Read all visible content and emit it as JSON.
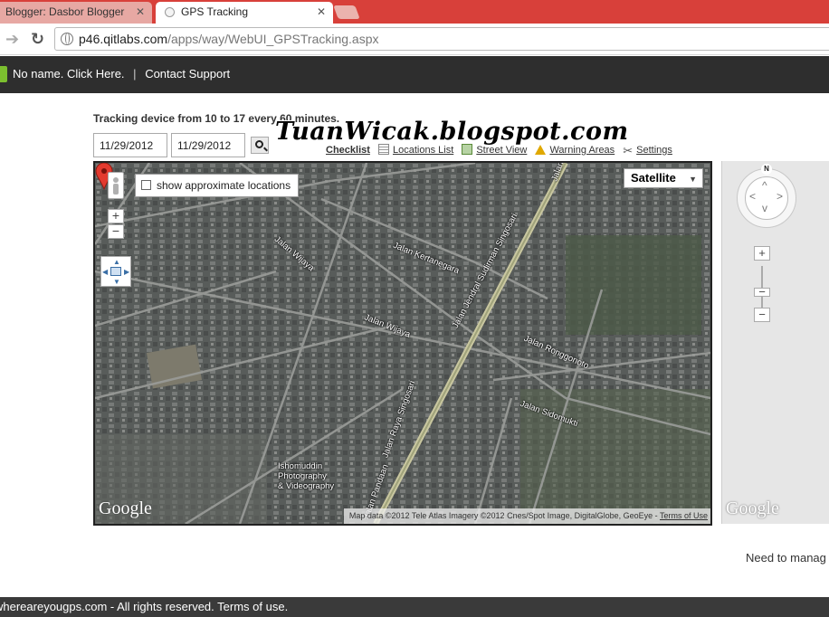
{
  "browser": {
    "tabs": [
      {
        "title": "Blogger: Dasbor Blogger",
        "active": false
      },
      {
        "title": "GPS Tracking",
        "active": true
      }
    ],
    "url_domain": "p46.qitlabs.com",
    "url_path": "/apps/way/WebUI_GPSTracking.aspx"
  },
  "site_header": {
    "account_link": "No name. Click Here.",
    "separator": "|",
    "support_link": "Contact Support"
  },
  "page": {
    "heading": "Tracking device from 10 to 17 every 60 minutes.",
    "date_from": "11/29/2012",
    "date_to": "11/29/2012",
    "watermark": "TuanWicak.blogspot.com",
    "menu": {
      "checklist": "Checklist",
      "locations_list": "Locations List",
      "street_view": "Street View",
      "warning_areas": "Warning Areas",
      "settings": "Settings"
    }
  },
  "map": {
    "show_approximate": "show approximate locations",
    "map_type": "Satellite",
    "google_logo": "Google",
    "copyright": "Map data ©2012 Tele Atlas Imagery ©2012 Cnes/Spot Image, DigitalGlobe, GeoEye - ",
    "terms": "Terms of Use",
    "zoom_in": "+",
    "zoom_out": "−",
    "street_labels": {
      "wijaya1": "Jalan Wijaya",
      "kertanegara": "Jalan Kertanegara",
      "sudirman": "Jalan Jendral Sudirman Singosari",
      "wijaya2": "Jalan Wijaya",
      "ronggonoto": "Jalan Ronggonoto",
      "sidomukti": "Jalan Sidomukti",
      "raya_singosari": "Jalan Raya Singosari",
      "pandaan": "Jalan Pandaan",
      "top_road": "Jalan"
    },
    "poi": [
      "Ishomuddin",
      "Photography",
      "& Videography"
    ]
  },
  "side_map": {
    "north": "N",
    "zoom_in": "+",
    "zoom_out": "−",
    "google_logo": "Google"
  },
  "manage_text": "Need to manag",
  "footer": "whereareyougps.com - All rights reserved. Terms of use."
}
